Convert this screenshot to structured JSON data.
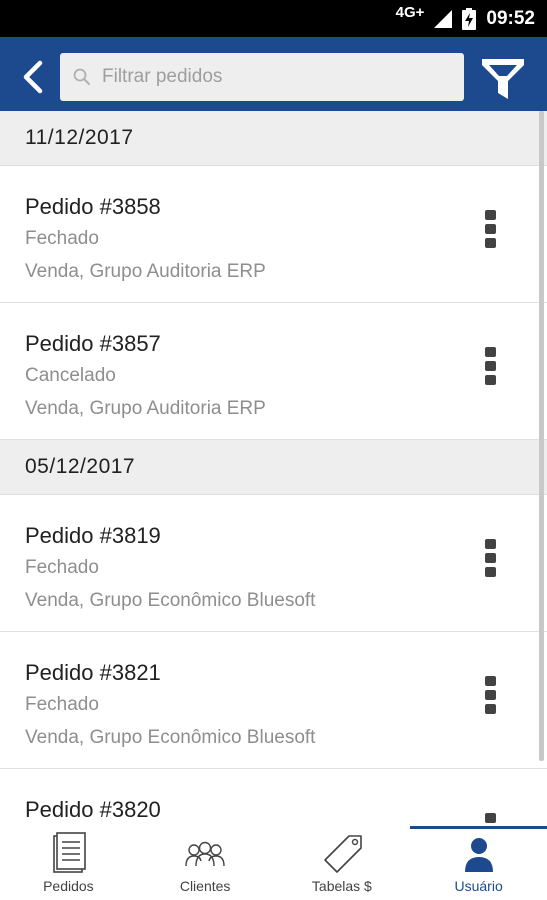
{
  "status_bar": {
    "network": "4G+",
    "time": "09:52"
  },
  "app_bar": {
    "search_placeholder": "Filtrar pedidos",
    "icons": {
      "back": "chevron-left-icon",
      "search": "search-icon",
      "filter": "funnel-filter-icon"
    }
  },
  "groups": [
    {
      "date": "11/12/2017",
      "orders": [
        {
          "title": "Pedido #3858",
          "status": "Fechado",
          "group": "Venda, Grupo Auditoria ERP"
        },
        {
          "title": "Pedido #3857",
          "status": "Cancelado",
          "group": "Venda, Grupo Auditoria ERP"
        }
      ]
    },
    {
      "date": "05/12/2017",
      "orders": [
        {
          "title": "Pedido #3819",
          "status": "Fechado",
          "group": "Venda, Grupo Econômico Bluesoft"
        },
        {
          "title": "Pedido #3821",
          "status": "Fechado",
          "group": "Venda, Grupo Econômico Bluesoft"
        },
        {
          "title": "Pedido #3820",
          "status": "",
          "group": ""
        }
      ]
    }
  ],
  "bottom_nav": {
    "items": [
      {
        "label": "Pedidos",
        "icon": "document-list-icon",
        "active": false
      },
      {
        "label": "Clientes",
        "icon": "people-group-icon",
        "active": false
      },
      {
        "label": "Tabelas $",
        "icon": "price-tag-icon",
        "active": false
      },
      {
        "label": "Usuário",
        "icon": "user-icon",
        "active": true
      }
    ]
  },
  "colors": {
    "primary": "#1d4a8f",
    "status_bar": "#000000",
    "section_header_bg": "#eeeeee",
    "secondary_text": "#8e8e8e"
  }
}
